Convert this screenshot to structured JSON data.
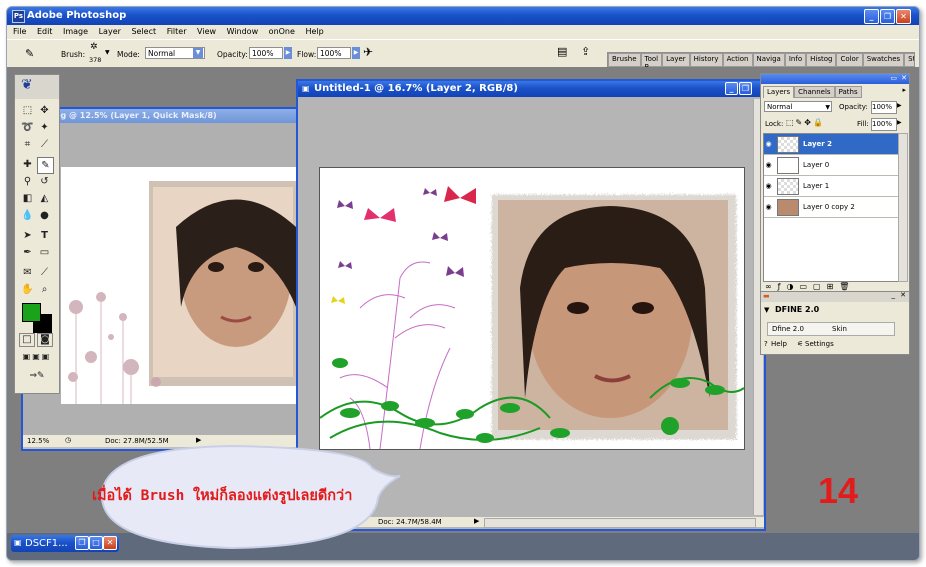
{
  "app": {
    "title": "Adobe Photoshop"
  },
  "menu": [
    "File",
    "Edit",
    "Image",
    "Layer",
    "Select",
    "Filter",
    "View",
    "Window",
    "onOne",
    "Help"
  ],
  "options": {
    "brush_label": "Brush:",
    "brush_size": "378",
    "mode_label": "Mode:",
    "mode_value": "Normal",
    "opacity_label": "Opacity:",
    "opacity_value": "100%",
    "flow_label": "Flow:",
    "flow_value": "100%"
  },
  "palette_well": [
    "Brushe",
    "Tool P",
    "Layer",
    "History",
    "Action",
    "Naviga",
    "Info",
    "Histog",
    "Color",
    "Swatches",
    "Styles"
  ],
  "doc_back": {
    "title": "og @ 12.5% (Layer 1, Quick Mask/8)",
    "zoom": "12.5%",
    "doc_info": "Doc: 27.8M/52.5M"
  },
  "doc_front": {
    "title": "Untitled-1 @ 16.7% (Layer 2, RGB/8)",
    "doc_info": "Doc: 24.7M/58.4M"
  },
  "layers_panel": {
    "tabs": [
      "Layers",
      "Channels",
      "Paths"
    ],
    "blend_mode": "Normal",
    "opacity_label": "Opacity:",
    "opacity_value": "100%",
    "lock_label": "Lock:",
    "fill_label": "Fill:",
    "fill_value": "100%",
    "layers": [
      "Layer 2",
      "Layer 0",
      "Layer 1",
      "Layer 0 copy 2"
    ],
    "selected_layer": "Layer 2"
  },
  "dfine_panel": {
    "title": "DFINE 2.0",
    "item": "Dfine 2.0",
    "value": "Skin",
    "help": "Help",
    "settings": "Settings"
  },
  "taskbar": {
    "item": "DSCF1..."
  },
  "caption": {
    "text": "เมื่อได้ Brush ใหม่ก็ลองแต่งรูปเลยดีกว่า",
    "page_number": "14"
  },
  "colors": {
    "caption_red": "#e21b1b",
    "foreground_swatch": "#1aa31a",
    "xp_blue": "#2457d6",
    "selected_layer": "#3169c6"
  }
}
